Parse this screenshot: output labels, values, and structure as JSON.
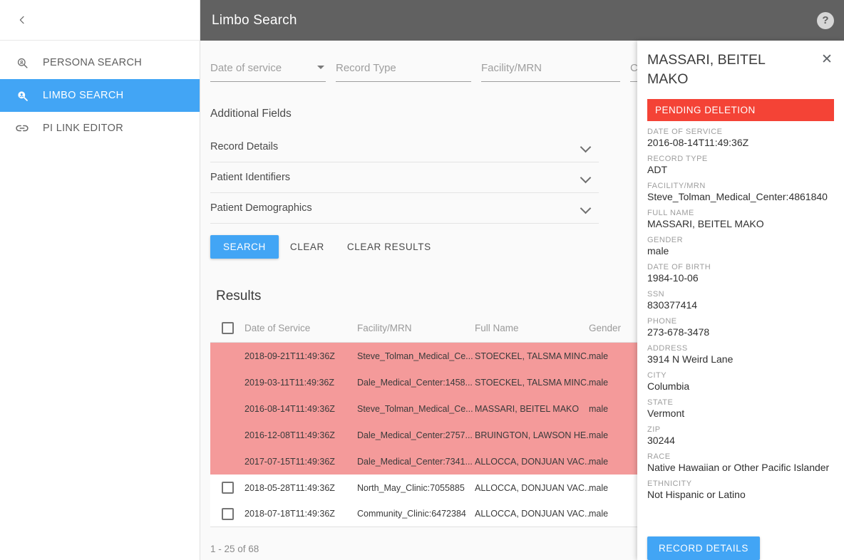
{
  "sidebar": {
    "back_icon": "chevron-left-icon",
    "items": [
      {
        "label": "PERSONA SEARCH",
        "icon": "search-outline-icon",
        "active": false
      },
      {
        "label": "LIMBO SEARCH",
        "icon": "search-filled-icon",
        "active": true
      },
      {
        "label": "PI LINK EDITOR",
        "icon": "link-icon",
        "active": false
      }
    ]
  },
  "topbar": {
    "title": "Limbo Search",
    "help_icon": "help-circle-icon",
    "help_label": "?",
    "background": "#616161"
  },
  "search_form": {
    "fields": [
      {
        "name": "date-of-service",
        "placeholder": "Date of service",
        "value": "",
        "has_dropdown": true
      },
      {
        "name": "record-type",
        "placeholder": "Record Type",
        "value": "",
        "has_dropdown": false
      },
      {
        "name": "facility-mrn",
        "placeholder": "Facility/MRN",
        "value": "",
        "has_dropdown": false
      },
      {
        "name": "current",
        "placeholder": "Cur",
        "value": "",
        "has_dropdown": false
      }
    ],
    "additional_fields_title": "Additional Fields",
    "accordions": [
      {
        "label": "Record Details",
        "icon": "chevron-down-icon"
      },
      {
        "label": "Patient Identifiers",
        "icon": "chevron-down-icon"
      },
      {
        "label": "Patient Demographics",
        "icon": "chevron-down-icon"
      }
    ],
    "buttons": {
      "search": "SEARCH",
      "clear": "CLEAR",
      "clear_results": "CLEAR RESULTS"
    },
    "accent_color": "#42A5F5"
  },
  "results": {
    "title": "Results",
    "columns": [
      "Date of Service",
      "Facility/MRN",
      "Full Name",
      "Gender"
    ],
    "flag_color": "#F49A9A",
    "rows": [
      {
        "checkbox": false,
        "flagged": true,
        "date_of_service": "2018-09-21T11:49:36Z",
        "facility_mrn": "Steve_Tolman_Medical_Ce...",
        "full_name": "STOECKEL, TALSMA MINC...",
        "gender": "male"
      },
      {
        "checkbox": false,
        "flagged": true,
        "date_of_service": "2019-03-11T11:49:36Z",
        "facility_mrn": "Dale_Medical_Center:1458...",
        "full_name": "STOECKEL, TALSMA MINC...",
        "gender": "male"
      },
      {
        "checkbox": false,
        "flagged": true,
        "date_of_service": "2016-08-14T11:49:36Z",
        "facility_mrn": "Steve_Tolman_Medical_Ce...",
        "full_name": "MASSARI, BEITEL MAKO",
        "gender": "male"
      },
      {
        "checkbox": false,
        "flagged": true,
        "date_of_service": "2016-12-08T11:49:36Z",
        "facility_mrn": "Dale_Medical_Center:2757...",
        "full_name": "BRUINGTON, LAWSON HE...",
        "gender": "male"
      },
      {
        "checkbox": false,
        "flagged": true,
        "date_of_service": "2017-07-15T11:49:36Z",
        "facility_mrn": "Dale_Medical_Center:7341...",
        "full_name": "ALLOCCA, DONJUAN VAC...",
        "gender": "male"
      },
      {
        "checkbox": true,
        "flagged": false,
        "date_of_service": "2018-05-28T11:49:36Z",
        "facility_mrn": "North_May_Clinic:7055885",
        "full_name": "ALLOCCA, DONJUAN VAC...",
        "gender": "male"
      },
      {
        "checkbox": true,
        "flagged": false,
        "date_of_service": "2018-07-18T11:49:36Z",
        "facility_mrn": "Community_Clinic:6472384",
        "full_name": "ALLOCCA, DONJUAN VAC...",
        "gender": "male"
      }
    ],
    "pagination": "1 - 25 of 68"
  },
  "detail_panel": {
    "title": "MASSARI, BEITEL MAKO",
    "close_icon": "close-icon",
    "badge": "PENDING DELETION",
    "badge_color": "#F44336",
    "fields": [
      {
        "label": "DATE OF SERVICE",
        "value": "2016-08-14T11:49:36Z"
      },
      {
        "label": "RECORD TYPE",
        "value": "ADT"
      },
      {
        "label": "FACILITY/MRN",
        "value": "Steve_Tolman_Medical_Center:4861840"
      },
      {
        "label": "FULL NAME",
        "value": "MASSARI, BEITEL MAKO"
      },
      {
        "label": "GENDER",
        "value": "male"
      },
      {
        "label": "DATE OF BIRTH",
        "value": "1984-10-06"
      },
      {
        "label": "SSN",
        "value": "830377414"
      },
      {
        "label": "PHONE",
        "value": "273-678-3478"
      },
      {
        "label": "ADDRESS",
        "value": "3914 N Weird Lane"
      },
      {
        "label": "CITY",
        "value": "Columbia"
      },
      {
        "label": "STATE",
        "value": "Vermont"
      },
      {
        "label": "ZIP",
        "value": "30244"
      },
      {
        "label": "RACE",
        "value": "Native Hawaiian or Other Pacific Islander"
      },
      {
        "label": "ETHNICITY",
        "value": "Not Hispanic or Latino"
      }
    ],
    "action_button": "RECORD DETAILS"
  }
}
